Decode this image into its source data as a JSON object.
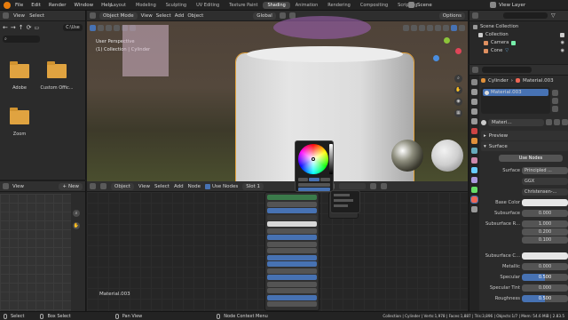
{
  "topbar": {
    "menus": [
      "File",
      "Edit",
      "Render",
      "Window",
      "Help"
    ],
    "workspaces": [
      "Layout",
      "Modeling",
      "Sculpting",
      "UV Editing",
      "Texture Paint",
      "Shading",
      "Animation",
      "Rendering",
      "Compositing",
      "Scripting"
    ],
    "active_workspace": "Shading",
    "scene": "Scene",
    "view_layer": "View Layer"
  },
  "filebrowser": {
    "path": "C:\\Use",
    "view_label": "View",
    "select_label": "Select",
    "items": [
      {
        "name": "Adobe"
      },
      {
        "name": "Custom Offic..."
      },
      {
        "name": "Zoom"
      }
    ]
  },
  "imagepanel": {
    "view_label": "View",
    "new_label": "New"
  },
  "viewport": {
    "mode": "Object Mode",
    "menus": [
      "View",
      "Select",
      "Add",
      "Object"
    ],
    "transform": "Global",
    "options": "Options",
    "overlay_title": "User Perspective",
    "overlay_sub": "(1) Collection | Cylinder"
  },
  "node_editor": {
    "mode": "Object",
    "menus": [
      "View",
      "Select",
      "Add",
      "Node"
    ],
    "use_nodes": "Use Nodes",
    "slot": "Slot 1",
    "material_name": "Material.003"
  },
  "outliner": {
    "title": "Scene Collection",
    "items": [
      "Collection",
      "Camera",
      "Cone"
    ]
  },
  "properties": {
    "object": "Cylinder",
    "material": "Material.003",
    "material_slot": "Material.003",
    "material_short": "Materi...",
    "preview": "Preview",
    "surface_header": "Surface",
    "use_nodes": "Use Nodes",
    "surface_label": "Surface",
    "surface_value": "Principled ...",
    "dist1": "GGX",
    "dist2": "Christensen-...",
    "base_color_label": "Base Color",
    "subsurface_label": "Subsurface",
    "subsurface_value": "0.000",
    "subsurface_r_label": "Subsurface R...",
    "subsurface_r_values": [
      "1.000",
      "0.200",
      "0.100"
    ],
    "subsurface_c_label": "Subsurface C...",
    "metallic_label": "Metallic",
    "metallic_value": "0.000",
    "specular_label": "Specular",
    "specular_value": "0.500",
    "specular_tint_label": "Specular Tint",
    "specular_tint_value": "0.000",
    "roughness_label": "Roughness",
    "roughness_value": "0.500"
  },
  "statusbar": {
    "items": [
      "Select",
      "Box Select",
      "Pan View",
      "Node Context Menu"
    ],
    "right": "Collection | Cylinder | Verts:1,978 | Faces:1,887 | Tris:3,896 | Objects:1/7 | Mem: 54.6 MiB | 2.83.5"
  },
  "colors": {
    "accent": "#4772b3",
    "folder": "#e0a340",
    "panel": "#303030"
  }
}
